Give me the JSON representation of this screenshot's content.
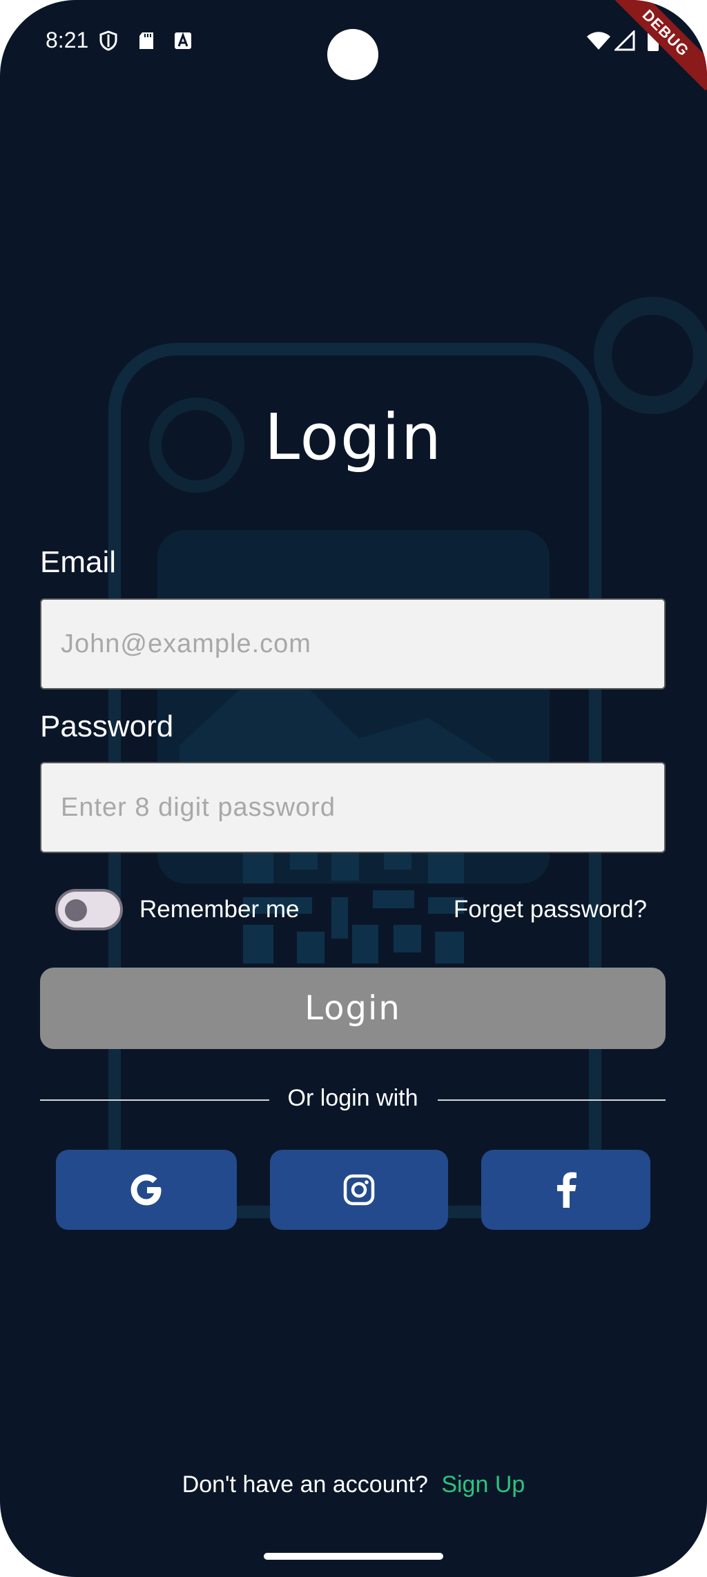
{
  "status_bar": {
    "time": "8:21",
    "icons_left": [
      "shield-icon",
      "sd-card-icon",
      "keyboard-a-icon"
    ],
    "icons_right": [
      "wifi-icon",
      "signal-icon",
      "battery-icon"
    ],
    "debug_label": "DEBUG"
  },
  "login": {
    "title": "Login",
    "email_label": "Email",
    "email_placeholder": "John@example.com",
    "email_value": "",
    "password_label": "Password",
    "password_placeholder": "Enter 8 digit password",
    "password_value": "",
    "remember_label": "Remember me",
    "remember_enabled": false,
    "forget_label": "Forget password?",
    "login_button_label": "Login",
    "divider_text": "Or login with",
    "social": [
      "google-icon",
      "instagram-icon",
      "facebook-icon"
    ]
  },
  "footer": {
    "prompt": "Don't have an account?",
    "signup_label": "Sign Up"
  },
  "colors": {
    "background": "#0a1628",
    "input_bg": "#f2f2f2",
    "login_button": "#8c8c8c",
    "social_button": "#234a8c",
    "signup_link": "#2ec27e",
    "debug_ribbon": "#8b1a1a"
  }
}
